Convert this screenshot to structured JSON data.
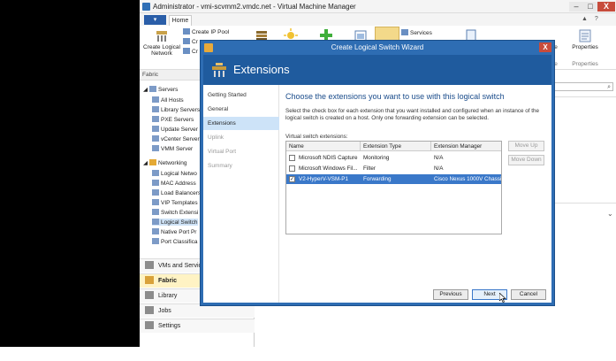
{
  "app": {
    "title": "Administrator - vmi-scvmm2.vmdc.net - Virtual Machine Manager",
    "min": "–",
    "max": "□",
    "close": "X"
  },
  "ribbon": {
    "file_tab": "▾",
    "home_tab": "Home",
    "help_icons": "▲ ?",
    "create_logical_network": "Create Logical Network",
    "create_ip_pool": "Create IP Pool",
    "create_partial_1": "Cr",
    "create_partial_2": "Cr",
    "services": "Services",
    "partial_ve_1": "ve",
    "partial_ve_2": "ve",
    "properties": "Properties",
    "properties_group": "Properties"
  },
  "leftnav": {
    "header": "Fabric",
    "tree": [
      {
        "label": "Servers",
        "icon": "servers-icon"
      },
      {
        "label": "All Hosts",
        "icon": "hosts-icon"
      },
      {
        "label": "Library Servers",
        "icon": "library-server-icon"
      },
      {
        "label": "PXE Servers",
        "icon": "pxe-icon"
      },
      {
        "label": "Update Server",
        "icon": "update-server-icon"
      },
      {
        "label": "vCenter Server",
        "icon": "vcenter-icon"
      },
      {
        "label": "VMM Server",
        "icon": "vmm-server-icon"
      },
      {
        "label": "Networking",
        "icon": "networking-icon"
      },
      {
        "label": "Logical Netwo",
        "icon": "logical-network-icon"
      },
      {
        "label": "MAC Address",
        "icon": "mac-icon"
      },
      {
        "label": "Load Balancers",
        "icon": "load-balancer-icon"
      },
      {
        "label": "VIP Templates",
        "icon": "vip-icon"
      },
      {
        "label": "Switch Extensi",
        "icon": "switch-extension-icon"
      },
      {
        "label": "Logical Switch",
        "icon": "logical-switch-icon"
      },
      {
        "label": "Native Port Pr",
        "icon": "port-profile-icon"
      },
      {
        "label": "Port Classifica",
        "icon": "port-classification-icon"
      }
    ],
    "workspaces": [
      {
        "label": "VMs and Services",
        "icon": "vms-icon"
      },
      {
        "label": "Fabric",
        "icon": "fabric-icon"
      },
      {
        "label": "Library",
        "icon": "library-icon"
      },
      {
        "label": "Jobs",
        "icon": "jobs-icon"
      },
      {
        "label": "Settings",
        "icon": "settings-icon"
      }
    ]
  },
  "content": {
    "search_glyph": "⌕",
    "chevron": "⌄"
  },
  "wizard": {
    "title": "Create Logical Switch Wizard",
    "close": "X",
    "banner_title": "Extensions",
    "steps": [
      {
        "label": "Getting Started",
        "state": "done"
      },
      {
        "label": "General",
        "state": "done"
      },
      {
        "label": "Extensions",
        "state": "current"
      },
      {
        "label": "Uplink",
        "state": "disabled"
      },
      {
        "label": "Virtual Port",
        "state": "disabled"
      },
      {
        "label": "Summary",
        "state": "disabled"
      }
    ],
    "heading": "Choose the extensions you want to use with this logical switch",
    "description": "Select the check box for each extension that you want installed and configured when an instance of the logical switch is created on a host. Only one forwarding extension can be selected.",
    "table_label": "Virtual switch extensions:",
    "columns": [
      "Name",
      "Extension Type",
      "Extension Manager"
    ],
    "rows": [
      {
        "checked": false,
        "name": "Microsoft NDIS Capture",
        "type": "Monitoring",
        "manager": "N/A"
      },
      {
        "checked": false,
        "name": "Microsoft Windows Fil...",
        "type": "Filter",
        "manager": "N/A"
      },
      {
        "checked": true,
        "name": "V2-HyperV-VSM-P1",
        "type": "Forwarding",
        "manager": "Cisco Nexus 1000V Chassi..."
      }
    ],
    "move_up": "Move Up",
    "move_down": "Move Down",
    "previous": "Previous",
    "next": "Next",
    "cancel": "Cancel"
  },
  "colors": {
    "wizard_frame": "#2e6db3",
    "banner": "#1f5b9e",
    "selection": "#3a78c9",
    "heading": "#1a4c8b",
    "active_workspace": "#fff3c4"
  }
}
